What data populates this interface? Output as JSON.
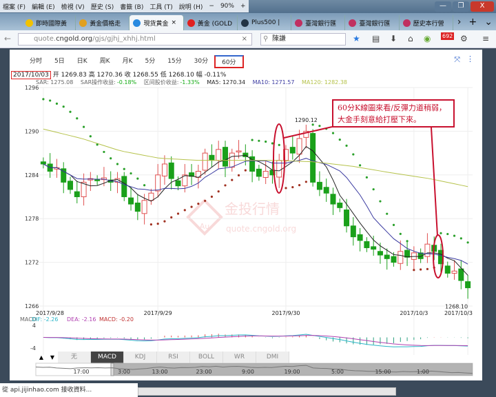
{
  "menu": {
    "items": [
      "檔案 (F)",
      "編輯 (E)",
      "檢視 (V)",
      "歷史 (S)",
      "書籤 (B)",
      "工具 (T)",
      "說明 (H)"
    ],
    "zoom": "90%",
    "zoom_out": "−",
    "zoom_in": "+"
  },
  "window": {
    "minimize": "—",
    "restore": "❐",
    "close": "X"
  },
  "tabs": [
    {
      "label": "即時國際黃",
      "color": "#f2c200"
    },
    {
      "label": "黃金價格走",
      "color": "#e0a020"
    },
    {
      "label": "現货黄金",
      "color": "#2a8ae0",
      "active": true,
      "close": "×"
    },
    {
      "label": "黃金 (GOLD",
      "color": "#e02020"
    },
    {
      "label": "Plus500 |",
      "color": "#234"
    },
    {
      "label": "臺灣銀行匯",
      "color": "#c03060"
    },
    {
      "label": "臺灣銀行匯",
      "color": "#c03060"
    },
    {
      "label": "歷史本行營",
      "color": "#c03060"
    }
  ],
  "tabs_controls": {
    "more": "›",
    "new": "+",
    "list": "⌄"
  },
  "nav": {
    "url_host": "quote.",
    "url_domain": "cngold.org",
    "url_path": "/gjs/gjhj_xhhj.html",
    "clear": "×",
    "search_value": "陳謙",
    "badge": "692"
  },
  "periods": [
    "分时",
    "5日",
    "日K",
    "周K",
    "月K",
    "5分",
    "15分",
    "30分",
    "60分"
  ],
  "active_period": "60分",
  "info": {
    "date": "2017/10/03",
    "open_label": "开",
    "open": "1269.83",
    "high_label": "高",
    "high": "1270.36",
    "close_label": "收",
    "close": "1268.55",
    "low_label": "低",
    "low": "1268.10",
    "chg_label": "幅",
    "chg": "-0.11%"
  },
  "indicators": {
    "sar": "SAR: 1275.08",
    "sar_ret_label": "SAR操作收益:",
    "sar_ret": "-0.18%",
    "range_label": "区间股价收益:",
    "range_ret": "-1.33%",
    "ma5": "MA5: 1270.34",
    "ma10": "MA10: 1271.57",
    "ma120": "MA120: 1282.38"
  },
  "macd_legend": {
    "title": "MACD",
    "dif": "DIF: -2.26",
    "dea": "DEA: -2.16",
    "macd": "MACD: -0.20",
    "ymax": "4",
    "ymin": "-4"
  },
  "indicator_tabs": [
    "无",
    "MACD",
    "KDJ",
    "RSI",
    "BOLL",
    "WR",
    "DMI"
  ],
  "active_indicator": "MACD",
  "nav_arrows": [
    "▲",
    "▼"
  ],
  "navigator_labels": [
    "17:00",
    "3:00",
    "13:00",
    "23:00",
    "9:00",
    "19:00",
    "5:00",
    "15:00",
    "1:00"
  ],
  "annotation": "60分K線圖來看/反彈力道稍弱，大金手刻意給打壓下來。",
  "watermark": {
    "brand": "金投行情",
    "url": "quote.cngold.org",
    "mark": "Au"
  },
  "status": "從 api.jijinhao.com 接收資料...",
  "colors": {
    "up": "#e05050",
    "down": "#1aa01a",
    "ma5": "#222222",
    "ma10": "#3a3aa0",
    "ma120": "#b5c24a",
    "sar_up": "#2aa02a",
    "sar_down": "#a03020",
    "annotation": "#c8102e"
  },
  "chart_data": {
    "type": "candlestick",
    "title": "现货黄金 60分",
    "ylim": [
      1266,
      1296
    ],
    "yticks": [
      "1296",
      "1290",
      "1284",
      "1278",
      "1272",
      "1266"
    ],
    "xticks": [
      {
        "label": "2017/9/28",
        "i": 0
      },
      {
        "label": "2017/9/29",
        "i": 17
      },
      {
        "label": "2017/9/30",
        "i": 36
      },
      {
        "label": "2017/10/3",
        "i": 55
      },
      {
        "label": "2017/10/3",
        "i": 63
      }
    ],
    "max_label": "1290.12",
    "min_label": "1268.10",
    "closes": [
      1285.5,
      1284.5,
      1285,
      1283,
      1282,
      1281,
      1283,
      1283.5,
      1283.2,
      1283.6,
      1283,
      1283.5,
      1281,
      1280,
      1279,
      1280.5,
      1281.5,
      1284,
      1285.5,
      1283.5,
      1282.5,
      1284,
      1283.8,
      1284.5,
      1287,
      1286,
      1287.5,
      1285.2,
      1287,
      1287.3,
      1286.5,
      1284.5,
      1283.8,
      1284.5,
      1284,
      1286,
      1287.5,
      1287,
      1289,
      1290,
      1283,
      1282,
      1281.5,
      1280,
      1279.5,
      1277,
      1275.5,
      1275,
      1274,
      1273.8,
      1273,
      1272.5,
      1272,
      1273.5,
      1272.7,
      1273.3,
      1272.5,
      1274.5,
      1273.5,
      1271.8,
      1270.5,
      1270.8,
      1269.5,
      1268.5
    ],
    "ma120": [
      1290.3,
      1289,
      1287.3,
      1286.3,
      1286,
      1286,
      1286,
      1285.8,
      1285.2,
      1284.3,
      1283.5,
      1282.4
    ]
  }
}
